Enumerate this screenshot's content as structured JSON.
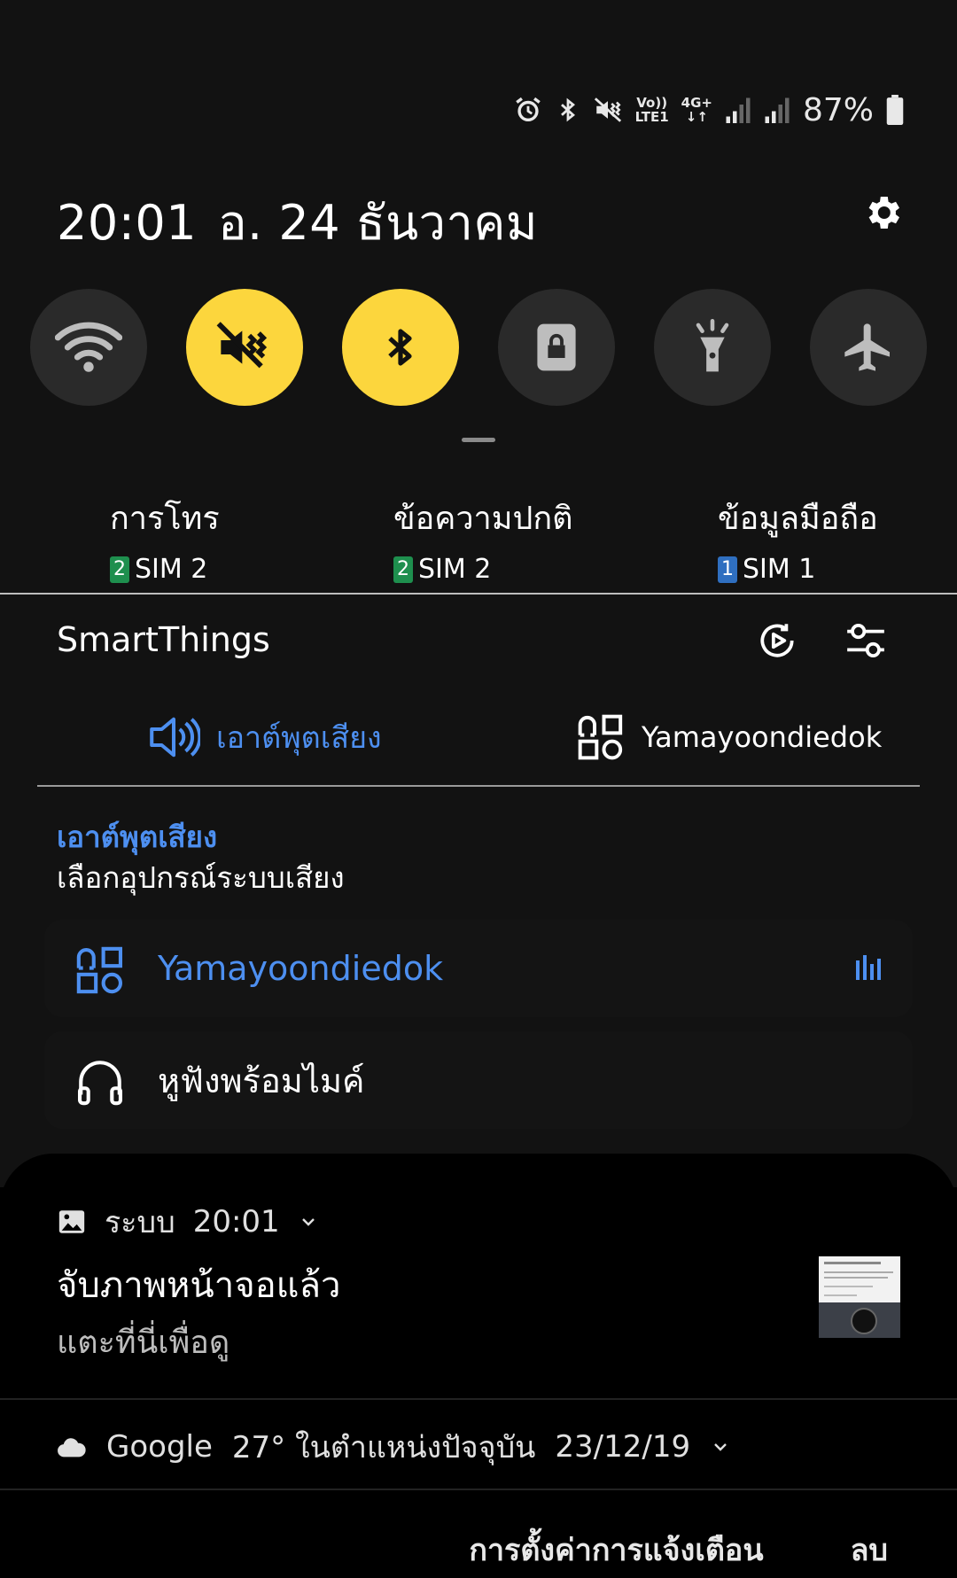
{
  "status_bar": {
    "volte": "Vo))",
    "lte": "LTE1",
    "net": "4G+",
    "battery": "87%",
    "icons": [
      "alarm-icon",
      "bluetooth-icon",
      "mute-vibrate-icon",
      "volte-icon",
      "4g-plus-icon",
      "signal-icon",
      "signal-icon",
      "battery-icon"
    ]
  },
  "header": {
    "time": "20:01",
    "date": "อ. 24 ธันวาคม"
  },
  "quick_toggles": [
    {
      "name": "wifi",
      "on": false
    },
    {
      "name": "mute",
      "on": true
    },
    {
      "name": "bluetooth",
      "on": true
    },
    {
      "name": "secure-folder",
      "on": false
    },
    {
      "name": "flashlight",
      "on": false
    },
    {
      "name": "airplane",
      "on": false
    }
  ],
  "sim": {
    "calls": {
      "label": "การโทร",
      "badge": "2",
      "sim": "SIM 2"
    },
    "messages": {
      "label": "ข้อความปกติ",
      "badge": "2",
      "sim": "SIM 2"
    },
    "data": {
      "label": "ข้อมูลมือถือ",
      "badge": "1",
      "sim": "SIM 1"
    }
  },
  "smartthings": {
    "title": "SmartThings",
    "tab_audio": "เอาต์พุตเสียง",
    "tab_device": "Yamayoondiedok",
    "section_title": "เอาต์พุตเสียง",
    "section_subtitle": "เลือกอุปกรณ์ระบบเสียง",
    "devices": [
      {
        "name": "Yamayoondiedok",
        "active": true
      },
      {
        "name": "หูฟังพร้อมไมค์",
        "active": false
      }
    ]
  },
  "notifications": {
    "screenshot": {
      "app": "ระบบ",
      "time": "20:01",
      "title": "จับภาพหน้าจอแล้ว",
      "body": "แตะที่นี่เพื่อดู"
    },
    "weather": {
      "app": "Google",
      "summary": "27° ในตำแหน่งปัจจุบัน",
      "date": "23/12/19"
    },
    "actions": {
      "settings": "การตั้งค่าการแจ้งเตือน",
      "clear": "ลบ"
    }
  },
  "colors": {
    "accent_yellow": "#fcd63d",
    "accent_blue": "#4d8ff0",
    "sim2_green": "#1e8f4e",
    "sim1_blue": "#2f6fc0"
  }
}
